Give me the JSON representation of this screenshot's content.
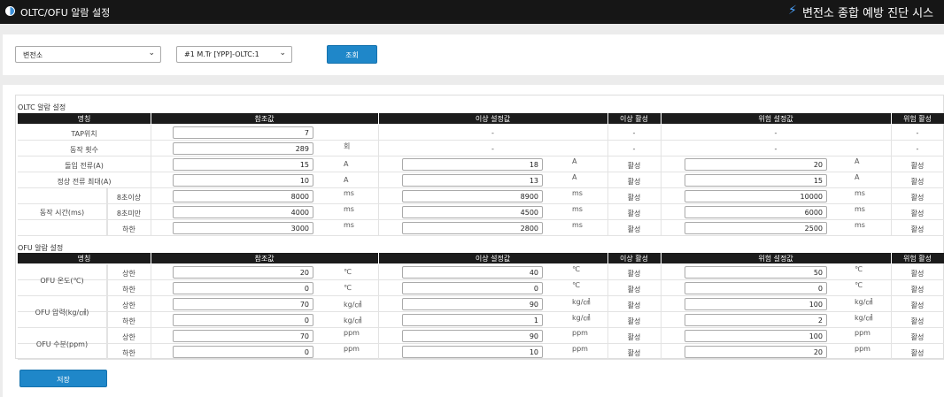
{
  "header": {
    "title": "OLTC/OFU 알람 설정",
    "system_name": "변전소 종합 예방 진단 시스"
  },
  "filter": {
    "substation": "변전소",
    "equipment": "#1 M.Tr [YPP]-OLTC:1",
    "search_label": "조회"
  },
  "oltc": {
    "title": "OLTC 알람 설정",
    "columns": [
      "명칭",
      "참조값",
      "이상 설정값",
      "이상 활성",
      "위험 설정값",
      "위험 활성"
    ],
    "rows": [
      {
        "name": "TAP위치",
        "sub": "",
        "ref": "7",
        "ref_unit": "",
        "warn": "-",
        "warn_unit": "",
        "warn_active": "-",
        "danger": "-",
        "danger_unit": "",
        "danger_active": "-"
      },
      {
        "name": "동작 횟수",
        "sub": "",
        "ref": "289",
        "ref_unit": "회",
        "warn": "-",
        "warn_unit": "",
        "warn_active": "-",
        "danger": "-",
        "danger_unit": "",
        "danger_active": "-"
      },
      {
        "name": "돌입 전류(A)",
        "sub": "",
        "ref": "15",
        "ref_unit": "A",
        "warn": "18",
        "warn_unit": "A",
        "warn_active": "활성",
        "danger": "20",
        "danger_unit": "A",
        "danger_active": "활성"
      },
      {
        "name": "정상 전류 최대(A)",
        "sub": "",
        "ref": "10",
        "ref_unit": "A",
        "warn": "13",
        "warn_unit": "A",
        "warn_active": "활성",
        "danger": "15",
        "danger_unit": "A",
        "danger_active": "활성"
      },
      {
        "name": "",
        "sub": "8초이상",
        "ref": "8000",
        "ref_unit": "ms",
        "warn": "8900",
        "warn_unit": "ms",
        "warn_active": "활성",
        "danger": "10000",
        "danger_unit": "ms",
        "danger_active": "활성"
      },
      {
        "name": "",
        "sub": "8초미만",
        "ref": "4000",
        "ref_unit": "ms",
        "warn": "4500",
        "warn_unit": "ms",
        "warn_active": "활성",
        "danger": "6000",
        "danger_unit": "ms",
        "danger_active": "활성"
      },
      {
        "name": "",
        "sub": "하한",
        "ref": "3000",
        "ref_unit": "ms",
        "warn": "2800",
        "warn_unit": "ms",
        "warn_active": "활성",
        "danger": "2500",
        "danger_unit": "ms",
        "danger_active": "활성"
      }
    ],
    "group_label": "동작 시간(ms)"
  },
  "ofu": {
    "title": "OFU 알람 설정",
    "columns": [
      "명칭",
      "참조값",
      "이상 설정값",
      "이상 활성",
      "위험 설정값",
      "위험 활성"
    ],
    "groups": [
      "OFU 온도(℃)",
      "OFU 압력(kg/㎠)",
      "OFU 수분(ppm)"
    ],
    "rows": [
      {
        "sub": "상한",
        "ref": "20",
        "ref_unit": "℃",
        "warn": "40",
        "warn_unit": "℃",
        "warn_active": "활성",
        "danger": "50",
        "danger_unit": "℃",
        "danger_active": "활성"
      },
      {
        "sub": "하한",
        "ref": "0",
        "ref_unit": "℃",
        "warn": "0",
        "warn_unit": "℃",
        "warn_active": "활성",
        "danger": "0",
        "danger_unit": "℃",
        "danger_active": "활성"
      },
      {
        "sub": "상한",
        "ref": "70",
        "ref_unit": "kg/㎠",
        "warn": "90",
        "warn_unit": "kg/㎠",
        "warn_active": "활성",
        "danger": "100",
        "danger_unit": "kg/㎠",
        "danger_active": "활성"
      },
      {
        "sub": "하한",
        "ref": "0",
        "ref_unit": "kg/㎠",
        "warn": "1",
        "warn_unit": "kg/㎠",
        "warn_active": "활성",
        "danger": "2",
        "danger_unit": "kg/㎠",
        "danger_active": "활성"
      },
      {
        "sub": "상한",
        "ref": "70",
        "ref_unit": "ppm",
        "warn": "90",
        "warn_unit": "ppm",
        "warn_active": "활성",
        "danger": "100",
        "danger_unit": "ppm",
        "danger_active": "활성"
      },
      {
        "sub": "하한",
        "ref": "0",
        "ref_unit": "ppm",
        "warn": "10",
        "warn_unit": "ppm",
        "warn_active": "활성",
        "danger": "20",
        "danger_unit": "ppm",
        "danger_active": "활성"
      }
    ]
  },
  "save_label": "저장",
  "colors": {
    "accent": "#1f87c9",
    "topbar": "#161616",
    "table_header": "#1b1b1b"
  }
}
